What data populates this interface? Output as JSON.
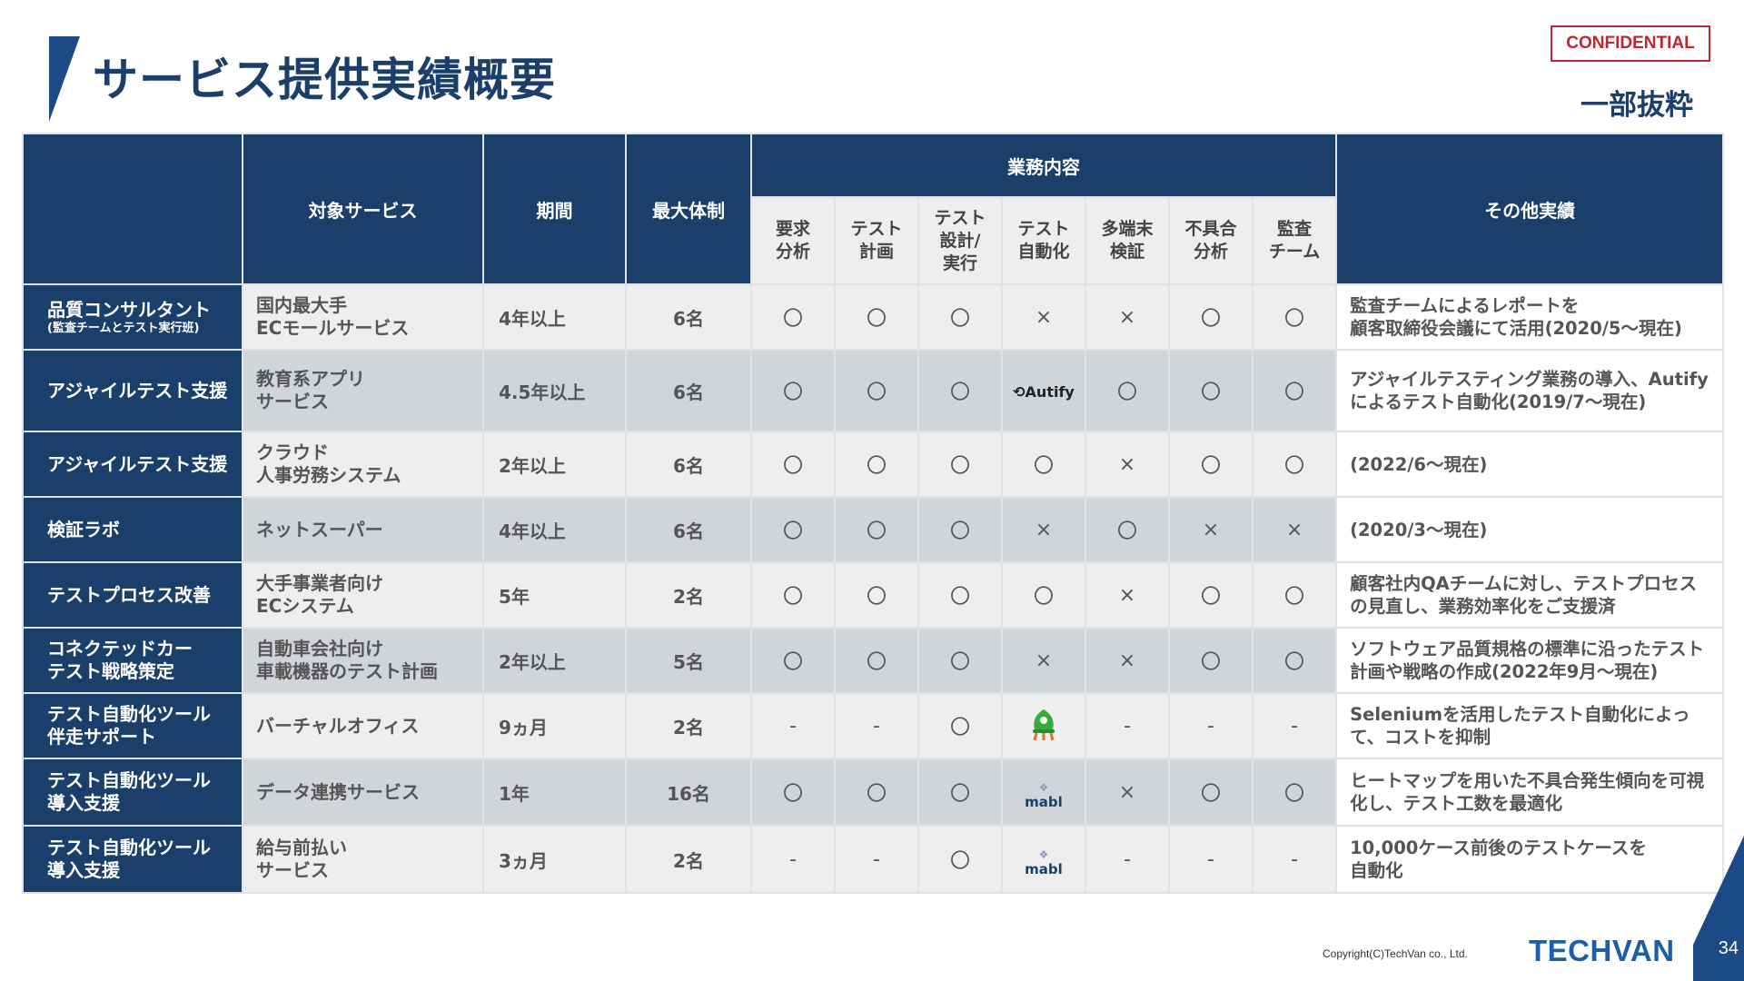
{
  "title": "サービス提供実績概要",
  "confidential": "CONFIDENTIAL",
  "excerpt": "一部抜粋",
  "colors": {
    "navy": "#1b3f6b",
    "brand": "#1b5faa",
    "confidential": "#c0262d"
  },
  "table": {
    "headers": {
      "service": "対象サービス",
      "period": "期間",
      "max_staff": "最大体制",
      "work": "業務内容",
      "other": "その他実績",
      "tasks": [
        "要求\n分析",
        "テスト\n計画",
        "テスト\n設計/\n実行",
        "テスト\n自動化",
        "多端末\n検証",
        "不具合\n分析",
        "監査\nチーム"
      ]
    },
    "rows": [
      {
        "label": "品質コンサルタント",
        "sublabel": "(監査チームとテスト実行班)",
        "service": "国内最大手\nECモールサービス",
        "period": "4年以上",
        "staff": "6名",
        "marks": [
          "〇",
          "〇",
          "〇",
          "×",
          "×",
          "〇",
          "〇"
        ],
        "other": "監査チームによるレポートを\n顧客取締役会議にて活用(2020/5～現在)"
      },
      {
        "label": "アジャイルテスト支援",
        "service": "教育系アプリ\nサービス",
        "period": "4.5年以上",
        "staff": "6名",
        "marks": [
          "〇",
          "〇",
          "〇",
          "Autify",
          "〇",
          "〇",
          "〇"
        ],
        "other": "アジャイルテスティング業務の導入、Autifyによるテスト自動化(2019/7～現在)"
      },
      {
        "label": "アジャイルテスト支援",
        "service": "クラウド\n人事労務システム",
        "period": "2年以上",
        "staff": "6名",
        "marks": [
          "〇",
          "〇",
          "〇",
          "〇",
          "×",
          "〇",
          "〇"
        ],
        "other": "(2022/6～現在)"
      },
      {
        "label": "検証ラボ",
        "service": "ネットスーパー",
        "period": "4年以上",
        "staff": "6名",
        "marks": [
          "〇",
          "〇",
          "〇",
          "×",
          "〇",
          "×",
          "×"
        ],
        "other": "(2020/3～現在)"
      },
      {
        "label": "テストプロセス改善",
        "service": "大手事業者向け\nECシステム",
        "period": "5年",
        "staff": "2名",
        "marks": [
          "〇",
          "〇",
          "〇",
          "〇",
          "×",
          "〇",
          "〇"
        ],
        "other": "顧客社内QAチームに対し、テストプロセスの見直し、業務効率化をご支援済"
      },
      {
        "label": "コネクテッドカー\nテスト戦略策定",
        "service": "自動車会社向け\n車載機器のテスト計画",
        "period": "2年以上",
        "staff": "5名",
        "marks": [
          "〇",
          "〇",
          "〇",
          "×",
          "×",
          "〇",
          "〇"
        ],
        "other": "ソフトウェア品質規格の標準に沿ったテスト計画や戦略の作成(2022年9月～現在)"
      },
      {
        "label": "テスト自動化ツール\n伴走サポート",
        "service": "バーチャルオフィス",
        "period": "9ヵ月",
        "staff": "2名",
        "marks": [
          "-",
          "-",
          "〇",
          "selenium-logo",
          "-",
          "-",
          "-"
        ],
        "other": "Seleniumを活用したテスト自動化によって、コストを抑制"
      },
      {
        "label": "テスト自動化ツール\n導入支援",
        "service": "データ連携サービス",
        "period": "1年",
        "staff": "16名",
        "marks": [
          "〇",
          "〇",
          "〇",
          "mabl",
          "×",
          "〇",
          "〇"
        ],
        "other": "ヒートマップを用いた不具合発生傾向を可視化し、テスト工数を最適化"
      },
      {
        "label": "テスト自動化ツール\n導入支援",
        "service": "給与前払い\nサービス",
        "period": "3ヵ月",
        "staff": "2名",
        "marks": [
          "-",
          "-",
          "〇",
          "mabl",
          "-",
          "-",
          "-"
        ],
        "other": "10,000ケース前後のテストケースを\n自動化"
      }
    ]
  },
  "footer": {
    "copyright": "Copyright(C)TechVan co., Ltd.",
    "brand": "TECHVAN",
    "page": "34"
  }
}
